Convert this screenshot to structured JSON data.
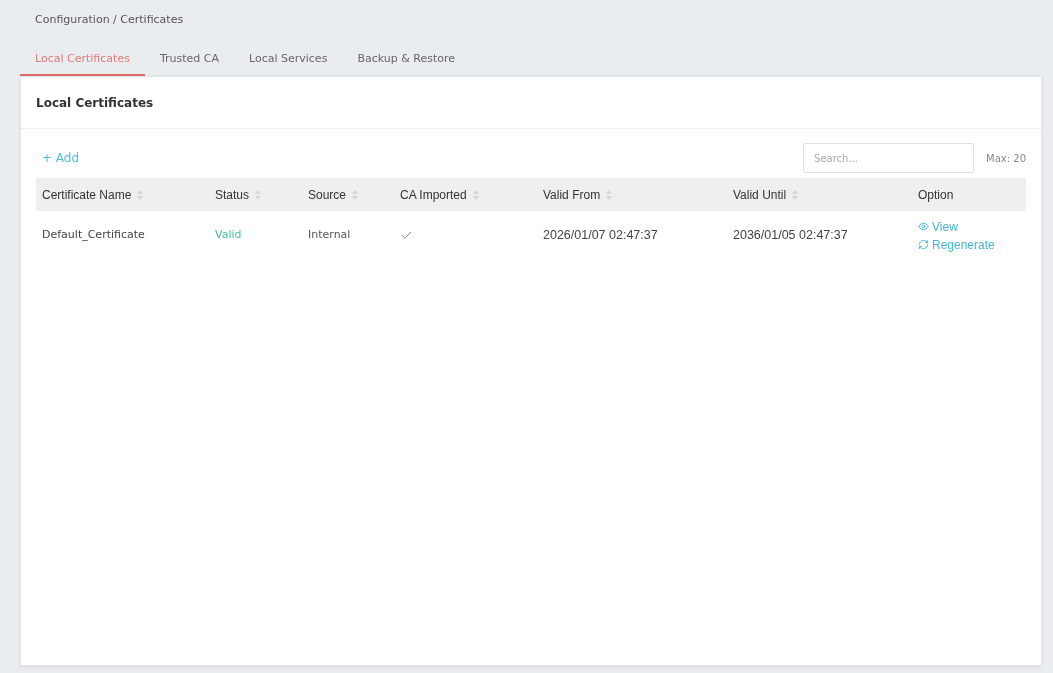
{
  "breadcrumb": "Configuration / Certificates",
  "tabs": [
    {
      "label": "Local Certificates",
      "selected": true
    },
    {
      "label": "Trusted CA",
      "selected": false
    },
    {
      "label": "Local Services",
      "selected": false
    },
    {
      "label": "Backup & Restore",
      "selected": false
    }
  ],
  "panel": {
    "title": "Local Certificates",
    "add_button": "+ Add",
    "search": {
      "placeholder": "Search..."
    },
    "max_note": "Max: 20"
  },
  "table": {
    "columns": [
      {
        "label": "Certificate Name",
        "sortable": true
      },
      {
        "label": "Status",
        "sortable": true
      },
      {
        "label": "Source",
        "sortable": true
      },
      {
        "label": "CA Imported",
        "sortable": true
      },
      {
        "label": "Valid From",
        "sortable": true
      },
      {
        "label": "Valid Until",
        "sortable": true
      },
      {
        "label": "Option",
        "sortable": false
      }
    ],
    "rows": [
      {
        "name": "Default_Certificate",
        "status": "Valid",
        "source": "Internal",
        "ca_imported": true,
        "valid_from": "2026/01/07 02:47:37",
        "valid_until": "2036/01/05 02:47:37",
        "options": [
          {
            "kind": "view",
            "label": "View"
          },
          {
            "kind": "regenerate",
            "label": "Regenerate"
          }
        ]
      }
    ]
  }
}
